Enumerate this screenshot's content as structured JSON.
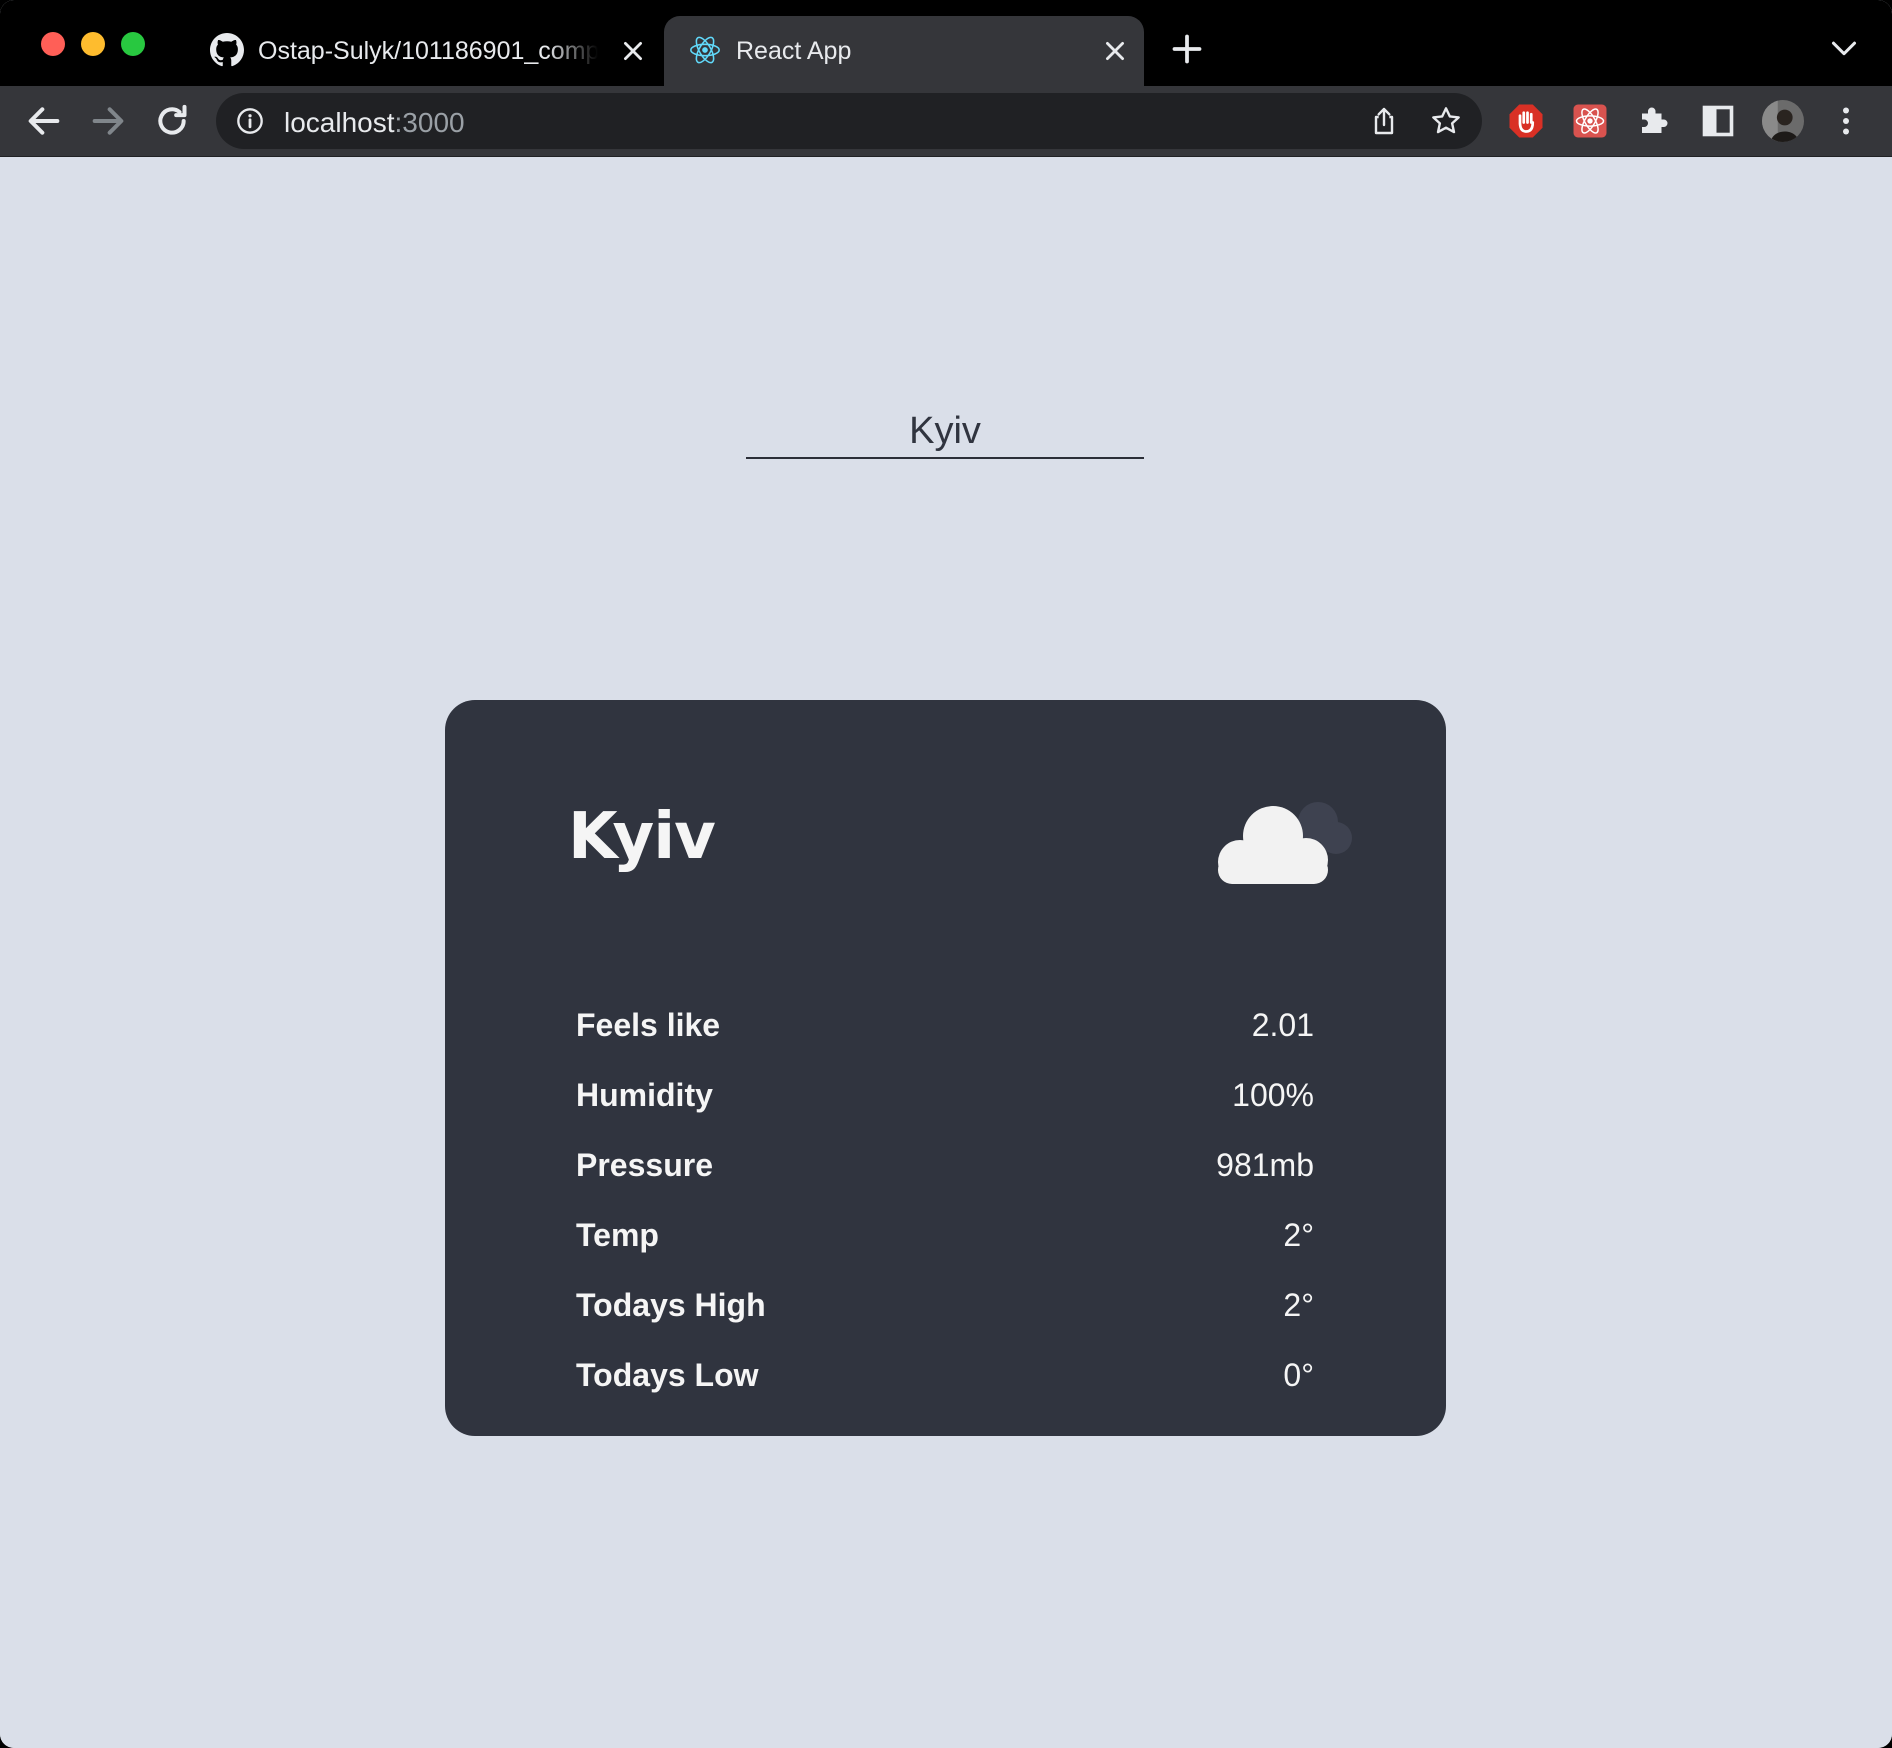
{
  "browser": {
    "tabs": [
      {
        "title": "Ostap-Sulyk/101186901_comp",
        "icon": "github-icon",
        "active": false
      },
      {
        "title": "React App",
        "icon": "react-icon",
        "active": true
      }
    ],
    "url_host": "localhost",
    "url_port": ":3000"
  },
  "search": {
    "value": "Kyiv"
  },
  "weather": {
    "city": "Kyiv",
    "icon": "cloud-icon",
    "stats": [
      {
        "label": "Feels like",
        "value": "2.01"
      },
      {
        "label": "Humidity",
        "value": "100%"
      },
      {
        "label": "Pressure",
        "value": "981mb"
      },
      {
        "label": "Temp",
        "value": "2°"
      },
      {
        "label": "Todays High",
        "value": "2°"
      },
      {
        "label": "Todays Low",
        "value": "0°"
      }
    ]
  },
  "colors": {
    "page_background": "#dadfe9",
    "card_background": "#30343f",
    "card_text": "#f5f5f5"
  }
}
